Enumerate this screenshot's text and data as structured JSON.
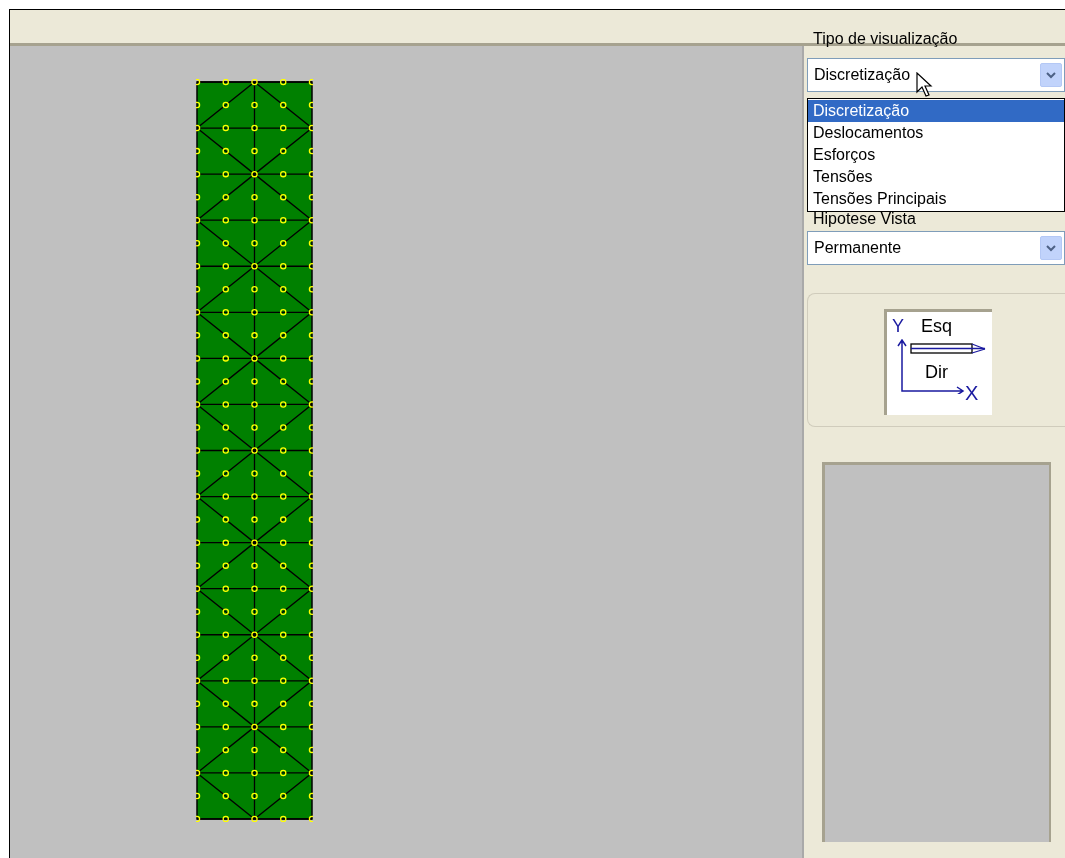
{
  "visualization": {
    "label": "Tipo de visualização",
    "value": "Discretização",
    "expanded": true,
    "options": [
      {
        "label": "Discretização",
        "selected": true
      },
      {
        "label": "Deslocamentos",
        "selected": false
      },
      {
        "label": "Esforços",
        "selected": false
      },
      {
        "label": "Tensões",
        "selected": false
      },
      {
        "label": "Tensões Principais",
        "selected": false
      }
    ]
  },
  "hypothesis": {
    "label": "Hipotese Vista",
    "value": "Permanente"
  },
  "orientation": {
    "y_label": "Y",
    "top_label": "Esq",
    "bottom_label": "Dir",
    "x_label": "X"
  }
}
